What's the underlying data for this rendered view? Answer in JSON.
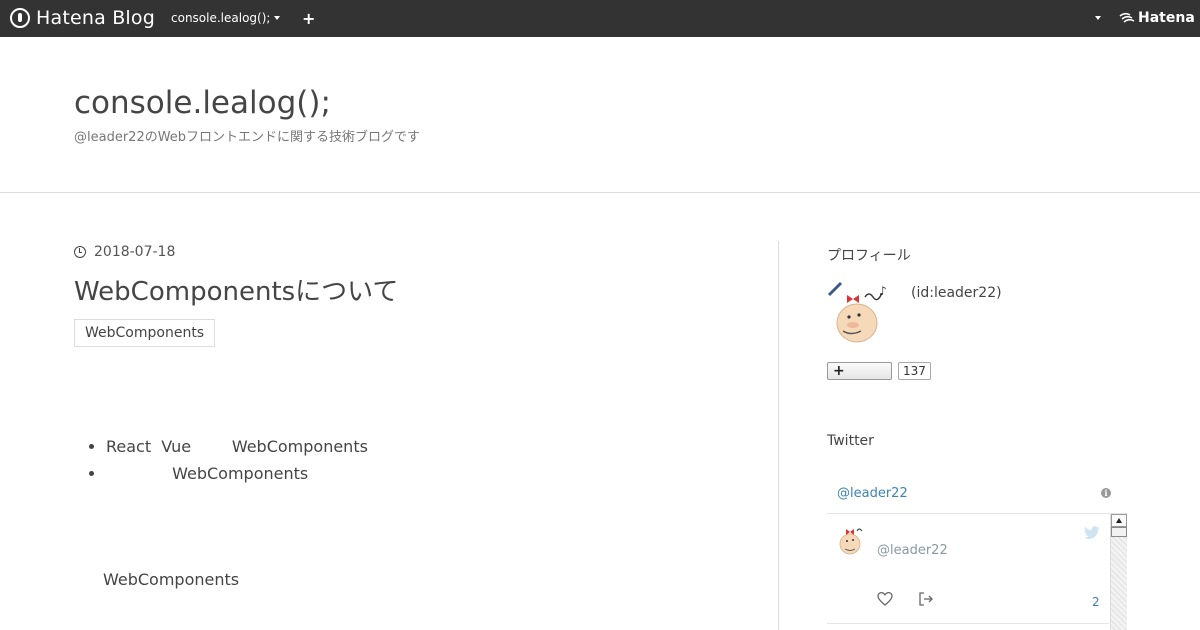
{
  "topbar": {
    "brand": "Hatena Blog",
    "blog_switch": "console.lealog();",
    "plus": "+",
    "hatena": "Hatena"
  },
  "blog": {
    "title": "console.lealog();",
    "description": "@leader22のWebフロントエンドに関する技術ブログです"
  },
  "entry": {
    "date": "2018-07-18",
    "title": "WebComponentsについて",
    "category": "WebComponents",
    "list": [
      "React  Vue        WebComponents",
      "             WebComponents"
    ],
    "paragraph": "WebComponents"
  },
  "sidebar": {
    "profile_heading": "プロフィール",
    "profile_id": "(id:leader22)",
    "follow_label": "+",
    "follow_count": "137",
    "twitter_heading": "Twitter",
    "tw_handle": "@leader22",
    "tw_user": "@leader22",
    "tw_count": "2"
  }
}
